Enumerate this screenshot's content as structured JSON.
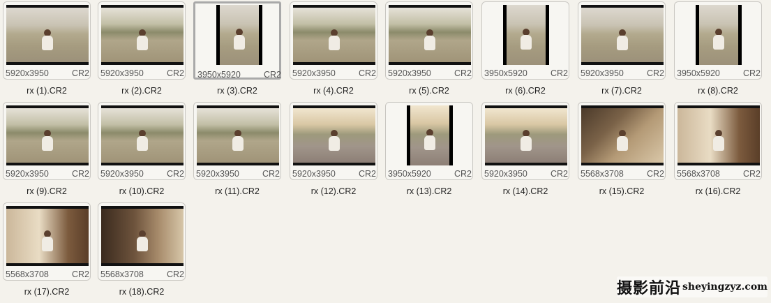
{
  "files": [
    {
      "name": "rx (1).CR2",
      "dimensions": "5920x3950",
      "type": "CR2",
      "orientation": "landscape",
      "scene": "field"
    },
    {
      "name": "rx (2).CR2",
      "dimensions": "5920x3950",
      "type": "CR2",
      "orientation": "landscape",
      "scene": "field2"
    },
    {
      "name": "rx (3).CR2",
      "dimensions": "3950x5920",
      "type": "CR2",
      "orientation": "portrait",
      "scene": "field",
      "selected": true
    },
    {
      "name": "rx (4).CR2",
      "dimensions": "5920x3950",
      "type": "CR2",
      "orientation": "landscape",
      "scene": "field2"
    },
    {
      "name": "rx (5).CR2",
      "dimensions": "5920x3950",
      "type": "CR2",
      "orientation": "landscape",
      "scene": "field2"
    },
    {
      "name": "rx (6).CR2",
      "dimensions": "3950x5920",
      "type": "CR2",
      "orientation": "portrait",
      "scene": "field"
    },
    {
      "name": "rx (7).CR2",
      "dimensions": "5920x3950",
      "type": "CR2",
      "orientation": "landscape",
      "scene": "field"
    },
    {
      "name": "rx (8).CR2",
      "dimensions": "3950x5920",
      "type": "CR2",
      "orientation": "portrait",
      "scene": "field"
    },
    {
      "name": "rx (9).CR2",
      "dimensions": "5920x3950",
      "type": "CR2",
      "orientation": "landscape",
      "scene": "field2"
    },
    {
      "name": "rx (10).CR2",
      "dimensions": "5920x3950",
      "type": "CR2",
      "orientation": "landscape",
      "scene": "field2"
    },
    {
      "name": "rx (11).CR2",
      "dimensions": "5920x3950",
      "type": "CR2",
      "orientation": "landscape",
      "scene": "field2"
    },
    {
      "name": "rx (12).CR2",
      "dimensions": "5920x3950",
      "type": "CR2",
      "orientation": "landscape",
      "scene": "sunset"
    },
    {
      "name": "rx (13).CR2",
      "dimensions": "3950x5920",
      "type": "CR2",
      "orientation": "portrait",
      "scene": "sunset"
    },
    {
      "name": "rx (14).CR2",
      "dimensions": "5920x3950",
      "type": "CR2",
      "orientation": "landscape",
      "scene": "sunset"
    },
    {
      "name": "rx (15).CR2",
      "dimensions": "5568x3708",
      "type": "CR2",
      "orientation": "landscape",
      "scene": "room"
    },
    {
      "name": "rx (16).CR2",
      "dimensions": "5568x3708",
      "type": "CR2",
      "orientation": "landscape",
      "scene": "room2"
    },
    {
      "name": "rx (17).CR2",
      "dimensions": "5568x3708",
      "type": "CR2",
      "orientation": "landscape",
      "scene": "room2"
    },
    {
      "name": "rx (18).CR2",
      "dimensions": "5568x3708",
      "type": "CR2",
      "orientation": "landscape",
      "scene": "room3"
    }
  ],
  "watermark": {
    "cn": "摄影前沿",
    "en": "sheyingzyz.com"
  }
}
